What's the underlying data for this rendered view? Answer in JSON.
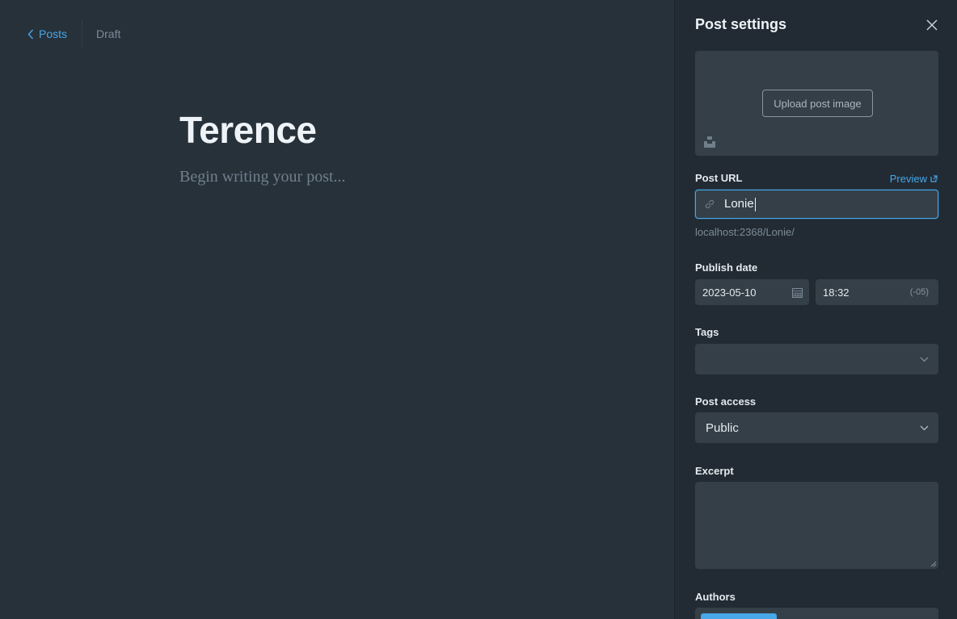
{
  "nav": {
    "back_label": "Posts",
    "status": "Draft"
  },
  "editor": {
    "title": "Terence",
    "body_placeholder": "Begin writing your post..."
  },
  "settings": {
    "header": "Post settings",
    "upload_label": "Upload post image",
    "post_url": {
      "label": "Post URL",
      "preview": "Preview",
      "value": "Lonie",
      "hint": "localhost:2368/Lonie/"
    },
    "publish": {
      "label": "Publish date",
      "date": "2023-05-10",
      "time": "18:32",
      "timezone": "(-05)"
    },
    "tags": {
      "label": "Tags",
      "value": ""
    },
    "access": {
      "label": "Post access",
      "value": "Public"
    },
    "excerpt": {
      "label": "Excerpt",
      "value": ""
    },
    "authors": {
      "label": "Authors"
    }
  },
  "colors": {
    "accent": "#47a7e8",
    "bg": "#27313a",
    "panel": "#222b33",
    "field": "#343f47"
  }
}
